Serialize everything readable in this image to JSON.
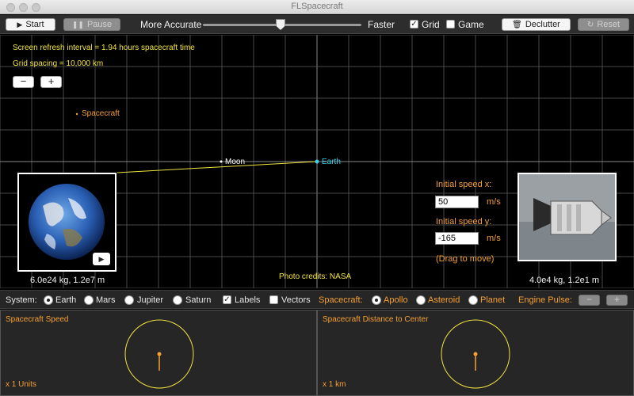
{
  "window": {
    "title": "FLSpacecraft"
  },
  "toolbar": {
    "start_label": "Start",
    "pause_label": "Pause",
    "more_accurate_label": "More Accurate",
    "faster_label": "Faster",
    "speed_slider_fraction": 0.5,
    "grid_label": "Grid",
    "grid_checked": true,
    "game_label": "Game",
    "game_checked": false,
    "declutter_label": "Declutter",
    "reset_label": "Reset"
  },
  "canvas": {
    "refresh_text": "Screen refresh interval = 1.94 hours spacecraft time",
    "grid_spacing_text": "Grid spacing = 10,000 km",
    "zoom_out_label": "−",
    "zoom_in_label": "+",
    "spacecraft_label": "Spacecraft",
    "moon_label": "Moon",
    "earth_label": "Earth",
    "initial_speed_x_label": "Initial speed x:",
    "initial_speed_x_value": "50",
    "initial_speed_y_label": "Initial speed y:",
    "initial_speed_y_value": "-165",
    "unit_label": "m/s",
    "drag_hint": "(Drag to move)",
    "photo_credits": "Photo credits: NASA",
    "earth_caption": "6.0e24 kg, 1.2e7 m",
    "craft_caption": "4.0e4 kg, 1.2e1 m",
    "colors": {
      "grid": "#4a4a4a",
      "trajectory": "#f2e341",
      "earth": "#3ad1ea",
      "spacecraft": "#f5a032",
      "moon": "#ffffff"
    }
  },
  "controls": {
    "system_label": "System:",
    "systems": [
      "Earth",
      "Mars",
      "Jupiter",
      "Saturn"
    ],
    "system_selected": "Earth",
    "labels_label": "Labels",
    "labels_checked": true,
    "vectors_label": "Vectors",
    "vectors_checked": false,
    "spacecraft_label": "Spacecraft:",
    "spacecraft_options": [
      "Apollo",
      "Asteroid",
      "Planet"
    ],
    "spacecraft_selected": "Apollo",
    "engine_pulse_label": "Engine Pulse:",
    "engine_minus": "−",
    "engine_plus": "+"
  },
  "panels": {
    "speed_title": "Spacecraft Speed",
    "speed_scale": "x 1 Units",
    "distance_title": "Spacecraft Distance to Center",
    "distance_scale": "x 1 km"
  }
}
